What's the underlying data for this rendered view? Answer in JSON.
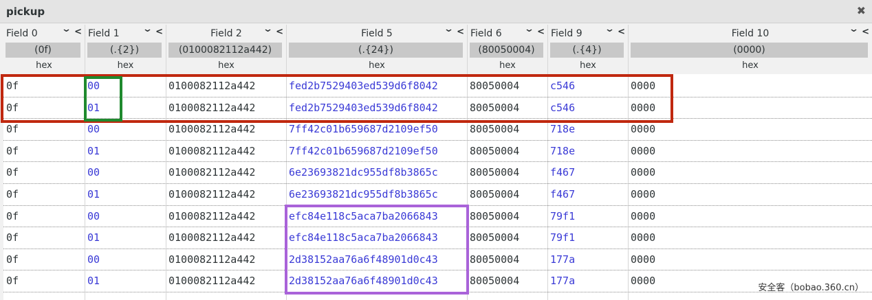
{
  "window": {
    "title": "pickup",
    "close_glyph": "✖"
  },
  "columns": [
    {
      "name": "Field 0",
      "filter": "(0f)",
      "format": "hex"
    },
    {
      "name": "Field 1",
      "filter": "(.{2})",
      "format": "hex"
    },
    {
      "name": "Field 2",
      "filter": "(0100082112a442)",
      "format": "hex"
    },
    {
      "name": "Field 5",
      "filter": "(.{24})",
      "format": "hex"
    },
    {
      "name": "Field 6",
      "filter": "(80050004)",
      "format": "hex"
    },
    {
      "name": "Field 9",
      "filter": "(.{4})",
      "format": "hex"
    },
    {
      "name": "Field 10",
      "filter": "(0000)",
      "format": "hex"
    }
  ],
  "controls": {
    "sort": "⌄",
    "collapse": "‹"
  },
  "rows": [
    [
      "0f",
      "00",
      "0100082112a442",
      "fed2b7529403ed539d6f8042",
      "80050004",
      "c546",
      "0000"
    ],
    [
      "0f",
      "01",
      "0100082112a442",
      "fed2b7529403ed539d6f8042",
      "80050004",
      "c546",
      "0000"
    ],
    [
      "0f",
      "00",
      "0100082112a442",
      "7ff42c01b659687d2109ef50",
      "80050004",
      "718e",
      "0000"
    ],
    [
      "0f",
      "01",
      "0100082112a442",
      "7ff42c01b659687d2109ef50",
      "80050004",
      "718e",
      "0000"
    ],
    [
      "0f",
      "00",
      "0100082112a442",
      "6e23693821dc955df8b3865c",
      "80050004",
      "f467",
      "0000"
    ],
    [
      "0f",
      "01",
      "0100082112a442",
      "6e23693821dc955df8b3865c",
      "80050004",
      "f467",
      "0000"
    ],
    [
      "0f",
      "00",
      "0100082112a442",
      "efc84e118c5aca7ba2066843",
      "80050004",
      "79f1",
      "0000"
    ],
    [
      "0f",
      "01",
      "0100082112a442",
      "efc84e118c5aca7ba2066843",
      "80050004",
      "79f1",
      "0000"
    ],
    [
      "0f",
      "00",
      "0100082112a442",
      "2d38152aa76a6f48901d0c43",
      "80050004",
      "177a",
      "0000"
    ],
    [
      "0f",
      "01",
      "0100082112a442",
      "2d38152aa76a6f48901d0c43",
      "80050004",
      "177a",
      "0000"
    ]
  ],
  "highlighted_columns": [
    1,
    3,
    5
  ],
  "colors": {
    "red_box": "#c0280f",
    "green_box": "#1f8a2e",
    "purple_box": "#a963d9",
    "link_text": "#3a3ad6"
  },
  "watermark": "安全客（bobao.360.cn）"
}
